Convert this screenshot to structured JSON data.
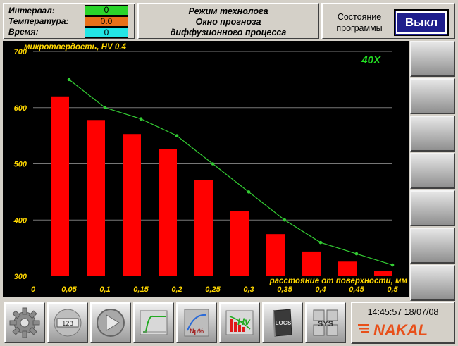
{
  "status": {
    "interval_label": "Интервал:",
    "interval_value": "0",
    "temperature_label": "Температура:",
    "temperature_value": "0.0",
    "time_label": "Время:",
    "time_value": "0",
    "interval_color": "#2ad42a",
    "temperature_color": "#e8701a",
    "time_color": "#22e6e6"
  },
  "title": {
    "line1": "Режим технолога",
    "line2": "Окно прогноза",
    "line3": "диффузионного процесса"
  },
  "program_state": {
    "label_line1": "Состояние",
    "label_line2": "программы",
    "button_label": "Выкл"
  },
  "chart_data": {
    "type": "bar",
    "ylabel": "микротвердость, HV 0.4",
    "xlabel": "расстояние от поверхности, мм",
    "magnification": "40X",
    "x_ticks": [
      "0",
      "0,05",
      "0,1",
      "0,15",
      "0,2",
      "0,25",
      "0,3",
      "0,35",
      "0,4",
      "0,45",
      "0,5"
    ],
    "y_ticks": [
      "700",
      "600",
      "500",
      "400",
      "300"
    ],
    "ylim": [
      300,
      700
    ],
    "x_range": [
      0,
      0.5
    ],
    "grid": true,
    "bar_color": "#ff0000",
    "line_color": "#33cc33",
    "bars": [
      {
        "x": 0.05,
        "value": 620
      },
      {
        "x": 0.1,
        "value": 578
      },
      {
        "x": 0.15,
        "value": 553
      },
      {
        "x": 0.2,
        "value": 526
      },
      {
        "x": 0.25,
        "value": 471
      },
      {
        "x": 0.3,
        "value": 416
      },
      {
        "x": 0.35,
        "value": 375
      },
      {
        "x": 0.4,
        "value": 344
      },
      {
        "x": 0.45,
        "value": 326
      },
      {
        "x": 0.5,
        "value": 310
      }
    ],
    "line": [
      {
        "x": 0.05,
        "y": 650
      },
      {
        "x": 0.1,
        "y": 600
      },
      {
        "x": 0.15,
        "y": 580
      },
      {
        "x": 0.2,
        "y": 550
      },
      {
        "x": 0.25,
        "y": 500
      },
      {
        "x": 0.3,
        "y": 450
      },
      {
        "x": 0.35,
        "y": 400
      },
      {
        "x": 0.4,
        "y": 360
      },
      {
        "x": 0.45,
        "y": 340
      },
      {
        "x": 0.5,
        "y": 320
      }
    ]
  },
  "toolbar": {
    "buttons": [
      {
        "icon": "gear-icon"
      },
      {
        "icon": "counter-icon",
        "text": "123"
      },
      {
        "icon": "play-icon"
      },
      {
        "icon": "curve-icon"
      },
      {
        "icon": "nitriding-icon",
        "text": "Np%"
      },
      {
        "icon": "hardness-icon",
        "text": "Hv"
      },
      {
        "icon": "logs-icon",
        "text": "LOGS"
      },
      {
        "icon": "system-icon",
        "text": "SYS"
      }
    ]
  },
  "clock": {
    "time": "14:45:57",
    "date": "18/07/08",
    "display": "14:45:57 18/07/08"
  },
  "brand": {
    "name": "NAKAL",
    "color": "#e8501a"
  }
}
